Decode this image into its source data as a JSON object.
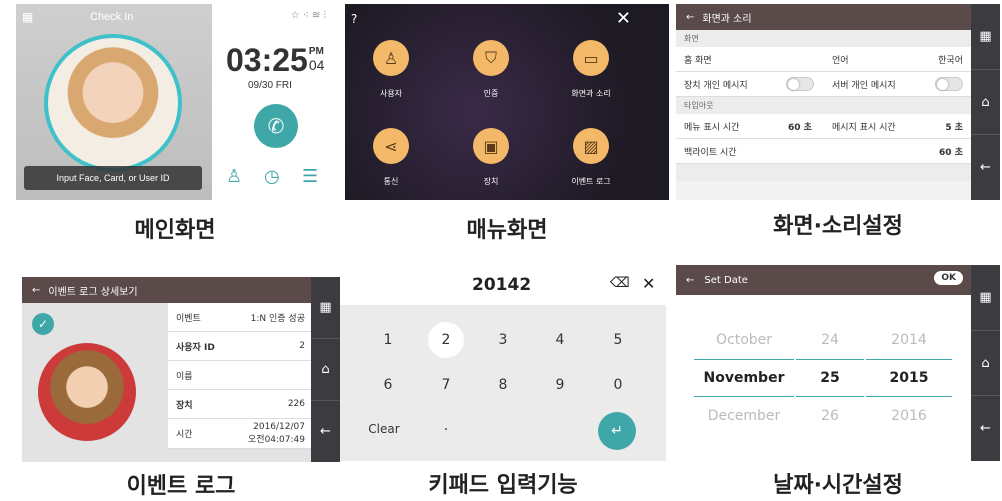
{
  "main_screen": {
    "title": "Check In",
    "time": "03:25",
    "ampm": "PM",
    "seconds": "04",
    "date": "09/30 FRI",
    "prompt": "Input Face, Card, or User ID",
    "caption": "메인화면"
  },
  "menu_screen": {
    "items": [
      {
        "label": "사용자",
        "icon": "person-icon"
      },
      {
        "label": "인증",
        "icon": "shield-check-icon"
      },
      {
        "label": "화면과 소리",
        "icon": "display-sound-icon"
      },
      {
        "label": "통신",
        "icon": "share-icon"
      },
      {
        "label": "장치",
        "icon": "device-icon"
      },
      {
        "label": "이벤트 로그",
        "icon": "image-log-icon"
      }
    ],
    "caption": "매뉴화면"
  },
  "display_settings": {
    "title": "화면과 소리",
    "section_screen": "화면",
    "home_label": "홈 화면",
    "language_label": "언어",
    "language_value": "한국어",
    "device_msg_label": "장치 개인 메시지",
    "server_msg_label": "서버 개인 메시지",
    "section_timeout": "타임아웃",
    "menu_time_label": "메뉴 표시 시간",
    "menu_time_value": "60 초",
    "msg_time_label": "메시지 표시 시간",
    "msg_time_value": "5 초",
    "backlight_label": "백라이트 시간",
    "backlight_value": "60 초",
    "caption": "화면·소리설정"
  },
  "event_log": {
    "title": "이벤트 로그 상세보기",
    "rows": [
      {
        "label": "이벤트",
        "value": "1:N 인증 성공"
      },
      {
        "label": "사용자 ID",
        "value": "2"
      },
      {
        "label": "이름",
        "value": ""
      },
      {
        "label": "장치",
        "value": "226"
      },
      {
        "label": "시간",
        "value": "2016/12/07"
      }
    ],
    "time_line2": "오전04:07:49",
    "caption": "이벤트 로그"
  },
  "keypad": {
    "input_value": "20142",
    "keys": [
      "1",
      "2",
      "3",
      "4",
      "5",
      "6",
      "7",
      "8",
      "9",
      "0"
    ],
    "clear_label": "Clear",
    "dot_label": "·",
    "caption": "키패드 입력기능"
  },
  "set_date": {
    "title": "Set Date",
    "ok_label": "OK",
    "months": [
      "October",
      "November",
      "December"
    ],
    "days": [
      "24",
      "25",
      "26"
    ],
    "years": [
      "2014",
      "2015",
      "2016"
    ],
    "caption": "날짜·시간설정"
  }
}
